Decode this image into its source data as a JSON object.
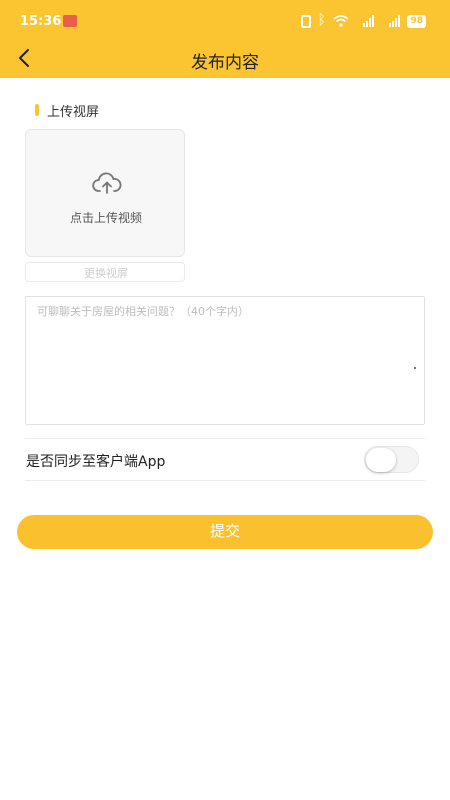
{
  "status_bar": {
    "time": "15:36",
    "battery": "98"
  },
  "nav": {
    "title": "发布内容",
    "back_icon": "chevron-left-icon"
  },
  "upload_section": {
    "title": "上传视屏",
    "upload_label": "点击上传视频",
    "upload_icon": "cloud-upload-icon",
    "replace_label": "更换视屏"
  },
  "question": {
    "placeholder": "可聊聊关于房屋的相关问题？（40个字内）",
    "value": ""
  },
  "sync": {
    "label": "是否同步至客户端App",
    "enabled": false
  },
  "submit": {
    "label": "提交"
  },
  "colors": {
    "accent": "#FBC531",
    "button": "#FBC02D"
  }
}
